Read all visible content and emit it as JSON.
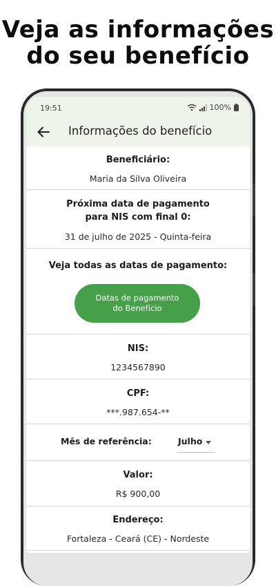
{
  "headline": {
    "line1": "Veja as informações",
    "line2": "do seu benefício"
  },
  "status_bar": {
    "time": "19:51",
    "battery": "100%"
  },
  "app_bar": {
    "title": "Informações do benefício"
  },
  "beneficiary": {
    "label": "Beneficiário:",
    "value": "Maria da Silva Oliveira"
  },
  "next_payment": {
    "label_line1": "Próxima data de pagamento",
    "label_line2": "para NIS com final 0:",
    "value": "31 de julho de 2025 - Quinta-feira"
  },
  "all_dates": {
    "label": "Veja todas as datas de pagamento:",
    "button_line1": "Datas de pagamento",
    "button_line2": "do Benefício"
  },
  "nis": {
    "label": "NIS:",
    "value": "1234567890"
  },
  "cpf": {
    "label": "CPF:",
    "value": "***.987.654-**"
  },
  "reference_month": {
    "label": "Mês de referência:",
    "selected": "Julho"
  },
  "amount": {
    "label": "Valor:",
    "value": "R$ 900,00"
  },
  "address": {
    "label": "Endereço:",
    "value": "Fortaleza - Ceará (CE) - Nordeste"
  },
  "colors": {
    "accent": "#46a049",
    "appbar_bg": "#eef4ea"
  },
  "icons": [
    "arrow-back-icon",
    "wifi-icon",
    "signal-icon",
    "battery-icon",
    "dropdown-caret-icon"
  ]
}
